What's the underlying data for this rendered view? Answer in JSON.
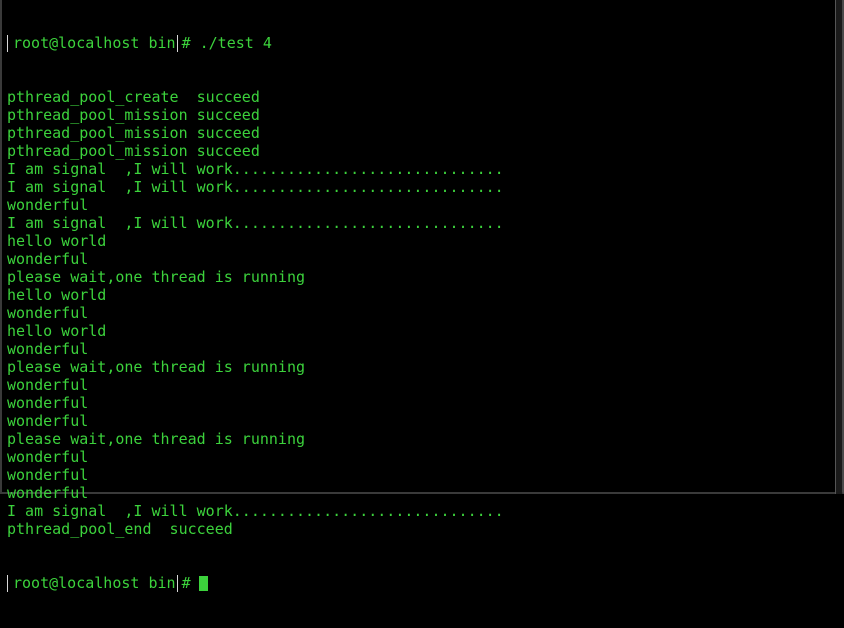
{
  "terminal": {
    "first_prompt": {
      "host": "root@localhost bin",
      "symbol": "#",
      "command": "./test 4"
    },
    "output_lines": [
      "pthread_pool_create  succeed",
      "pthread_pool_mission succeed",
      "pthread_pool_mission succeed",
      "pthread_pool_mission succeed",
      "I am signal  ,I will work..............................",
      "I am signal  ,I will work..............................",
      "wonderful",
      "I am signal  ,I will work..............................",
      "hello world",
      "wonderful",
      "please wait,one thread is running",
      "hello world",
      "wonderful",
      "hello world",
      "wonderful",
      "please wait,one thread is running",
      "wonderful",
      "wonderful",
      "wonderful",
      "please wait,one thread is running",
      "wonderful",
      "wonderful",
      "wonderful",
      "I am signal  ,I will work..............................",
      "pthread_pool_end  succeed"
    ],
    "last_prompt": {
      "host": "root@localhost bin",
      "symbol": "#"
    },
    "colors": {
      "background": "#000000",
      "text": "#3cd23c",
      "prompt_border": "#d8d8d8"
    }
  }
}
